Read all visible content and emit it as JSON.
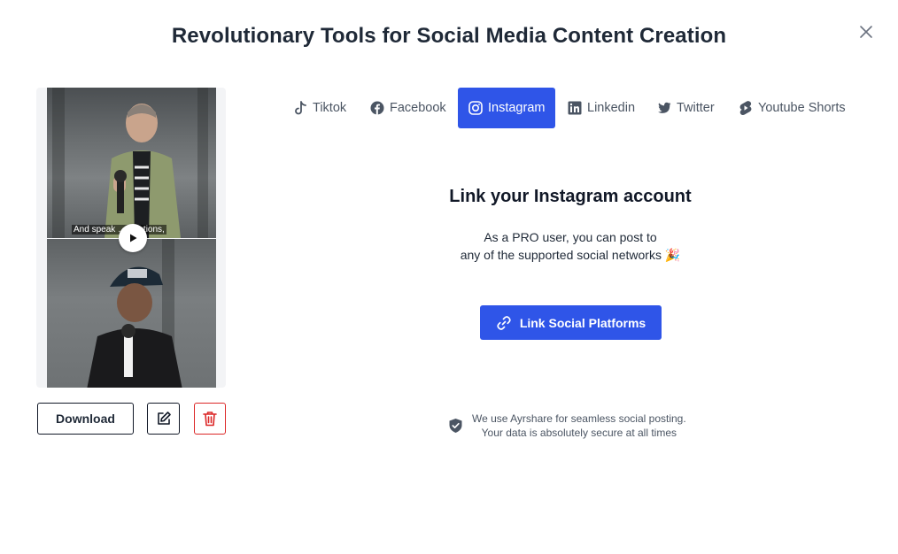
{
  "page": {
    "title": "Revolutionary Tools for Social Media Content Creation"
  },
  "preview": {
    "caption_text": "And speak … captions,"
  },
  "actions": {
    "download_label": "Download"
  },
  "tabs": [
    {
      "label": "Tiktok",
      "icon": "tiktok-icon",
      "active": false
    },
    {
      "label": "Facebook",
      "icon": "facebook-icon",
      "active": false
    },
    {
      "label": "Instagram",
      "icon": "instagram-icon",
      "active": true
    },
    {
      "label": "Linkedin",
      "icon": "linkedin-icon",
      "active": false
    },
    {
      "label": "Twitter",
      "icon": "twitter-icon",
      "active": false
    },
    {
      "label": "Youtube Shorts",
      "icon": "youtube-shorts-icon",
      "active": false
    }
  ],
  "panel": {
    "heading": "Link your Instagram account",
    "description_line1": "As a PRO user, you can post to",
    "description_line2": "any of the supported social networks",
    "emoji": "🎉",
    "link_button_label": "Link Social Platforms"
  },
  "security": {
    "line1": "We use Ayrshare for seamless social posting.",
    "line2": "Your data is absolutely secure at all times"
  },
  "colors": {
    "accent": "#2f55e8",
    "danger": "#dc2626",
    "text_dark": "#111827",
    "text_muted": "#4b5563"
  }
}
